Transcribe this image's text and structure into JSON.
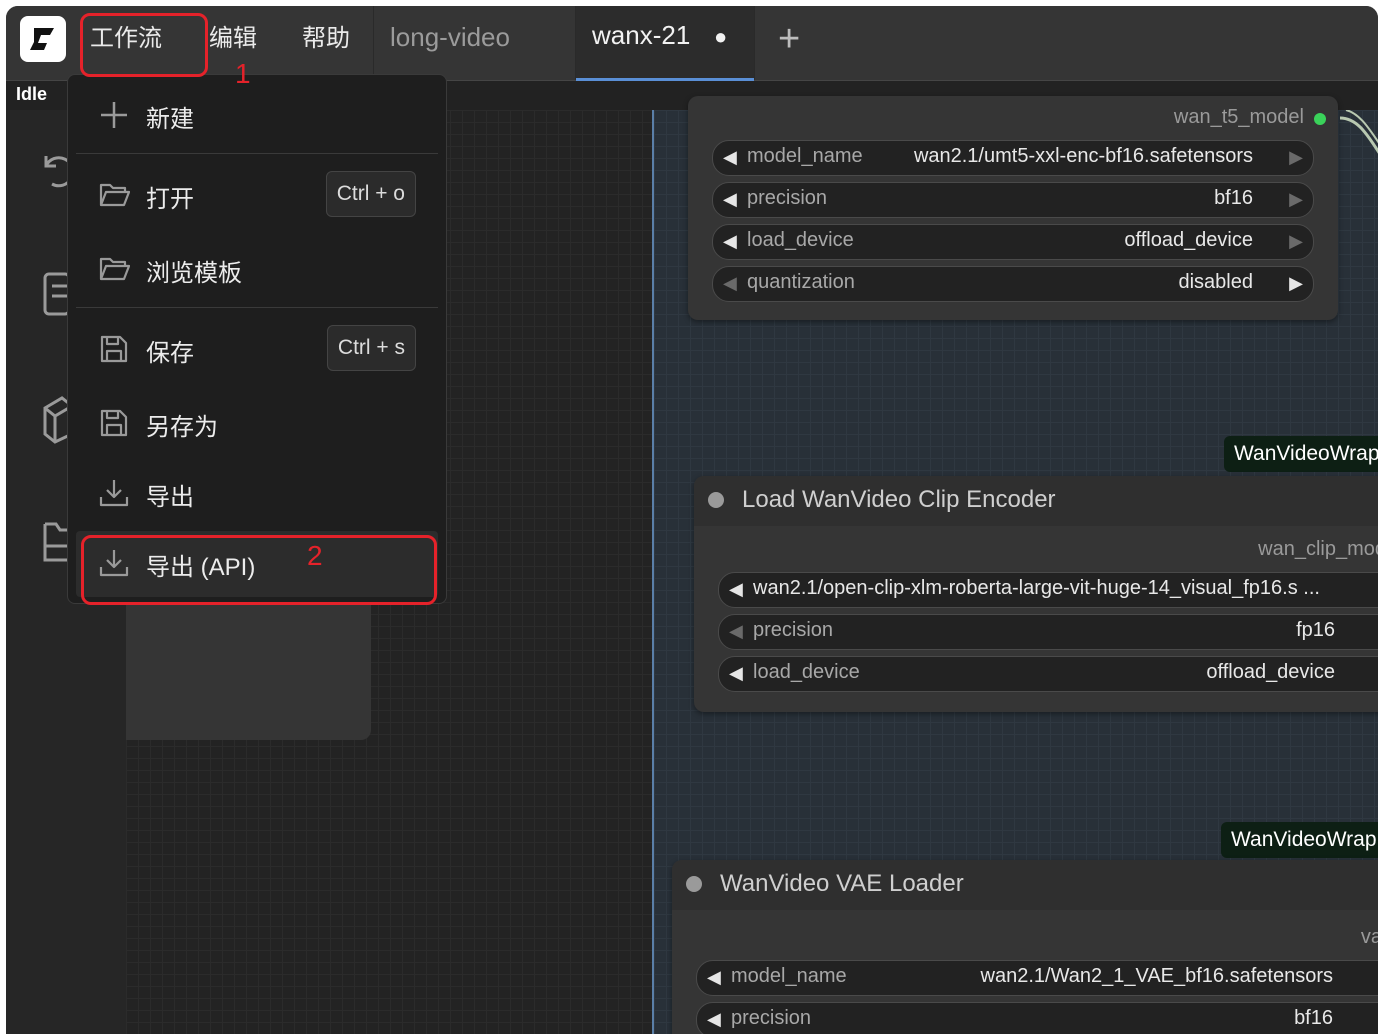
{
  "topbar": {
    "menus": [
      "工作流",
      "编辑",
      "帮助"
    ],
    "tabs": [
      {
        "label": "long-video"
      },
      {
        "label": "wanx-21",
        "modified_dot": "●"
      }
    ],
    "add_tab": "+"
  },
  "status": "Idle",
  "dropdown": {
    "items": [
      {
        "label": "新建",
        "icon": "plus-icon"
      },
      {
        "label": "打开",
        "shortcut": "Ctrl + o",
        "icon": "folder-open-icon"
      },
      {
        "label": "浏览模板",
        "icon": "folder-open-icon"
      },
      {
        "label": "保存",
        "shortcut": "Ctrl + s",
        "icon": "save-icon"
      },
      {
        "label": "另存为",
        "icon": "save-icon"
      },
      {
        "label": "导出",
        "icon": "download-icon"
      },
      {
        "label": "导出 (API)",
        "icon": "download-icon"
      }
    ]
  },
  "annotations": [
    "1",
    "2"
  ],
  "nodes": {
    "t5": {
      "output": "wan_t5_model",
      "widgets": [
        {
          "label": "model_name",
          "value": "wan2.1/umt5-xxl-enc-bf16.safetensors"
        },
        {
          "label": "precision",
          "value": "bf16"
        },
        {
          "label": "load_device",
          "value": "offload_device"
        },
        {
          "label": "quantization",
          "value": "disabled"
        }
      ]
    },
    "clip": {
      "badge": "WanVideoWrap",
      "title": "Load WanVideo Clip Encoder",
      "output": "wan_clip_mod",
      "widgets": [
        {
          "label": "wan2.1/open-clip-xlm-roberta-large-vit-huge-14_visual_fp16.s ...",
          "value": ""
        },
        {
          "label": "precision",
          "value": "fp16"
        },
        {
          "label": "load_device",
          "value": "offload_device"
        }
      ]
    },
    "vae": {
      "badge": "WanVideoWrap",
      "title": "WanVideo VAE Loader",
      "output": "va",
      "widgets": [
        {
          "label": "model_name",
          "value": "wan2.1/Wan2_1_VAE_bf16.safetensors"
        },
        {
          "label": "precision",
          "value": "bf16"
        }
      ]
    }
  },
  "colors": {
    "accent": "#e5222a",
    "tab_underline": "#5a8fd6",
    "badge_bg": "#0d1f14",
    "output_dot": "#3ad25a"
  }
}
